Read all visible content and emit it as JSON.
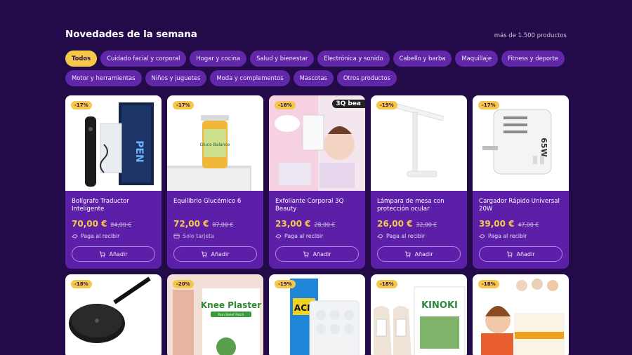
{
  "section": {
    "title": "Novedades de la semana",
    "count": "más de 1.500 productos"
  },
  "categories": [
    {
      "label": "Todos",
      "active": true
    },
    {
      "label": "Cuidado facial y corporal"
    },
    {
      "label": "Hogar y cocina"
    },
    {
      "label": "Salud y bienestar"
    },
    {
      "label": "Electrónica y sonido"
    },
    {
      "label": "Cabello y barba"
    },
    {
      "label": "Maquillaje"
    },
    {
      "label": "Fitness y deporte"
    },
    {
      "label": "Motor y herramientas"
    },
    {
      "label": "Niños y juguetes"
    },
    {
      "label": "Moda y complementos"
    },
    {
      "label": "Mascotas"
    },
    {
      "label": "Otros productos"
    }
  ],
  "add_label": "Añadir",
  "products": [
    {
      "badge": "-17%",
      "name": "Bolígrafo Traductor Inteligente",
      "price": "70,00 €",
      "old_price": "84,00 €",
      "payment": "Paga al recibir",
      "image_text": "PEN"
    },
    {
      "badge": "-17%",
      "name": "Equilibrio Glucémico 6",
      "price": "72,00 €",
      "old_price": "87,00 €",
      "payment": "Solo tarjeta",
      "image_text": "Gluco Balance"
    },
    {
      "badge": "-18%",
      "name": "Exfoliante Corporal 3Q Beauty",
      "price": "23,00 €",
      "old_price": "28,00 €",
      "payment": "Paga al recibir",
      "image_text": "3Q bea"
    },
    {
      "badge": "-19%",
      "name": "Lámpara de mesa con protección ocular",
      "price": "26,00 €",
      "old_price": "32,00 €",
      "payment": "Paga al recibir",
      "image_text": ""
    },
    {
      "badge": "-17%",
      "name": "Cargador Rápido Universal 20W",
      "price": "39,00 €",
      "old_price": "47,00 €",
      "payment": "Paga al recibir",
      "image_text": "65W"
    },
    {
      "badge": "-18%",
      "image_text": ""
    },
    {
      "badge": "-20%",
      "image_text": "Knee Plaster",
      "image_sub": "Pain Relief Patch"
    },
    {
      "badge": "-19%",
      "image_text": "ACN"
    },
    {
      "badge": "-18%",
      "image_text": "KINOKI"
    },
    {
      "badge": "-18%",
      "image_text": ""
    }
  ]
}
